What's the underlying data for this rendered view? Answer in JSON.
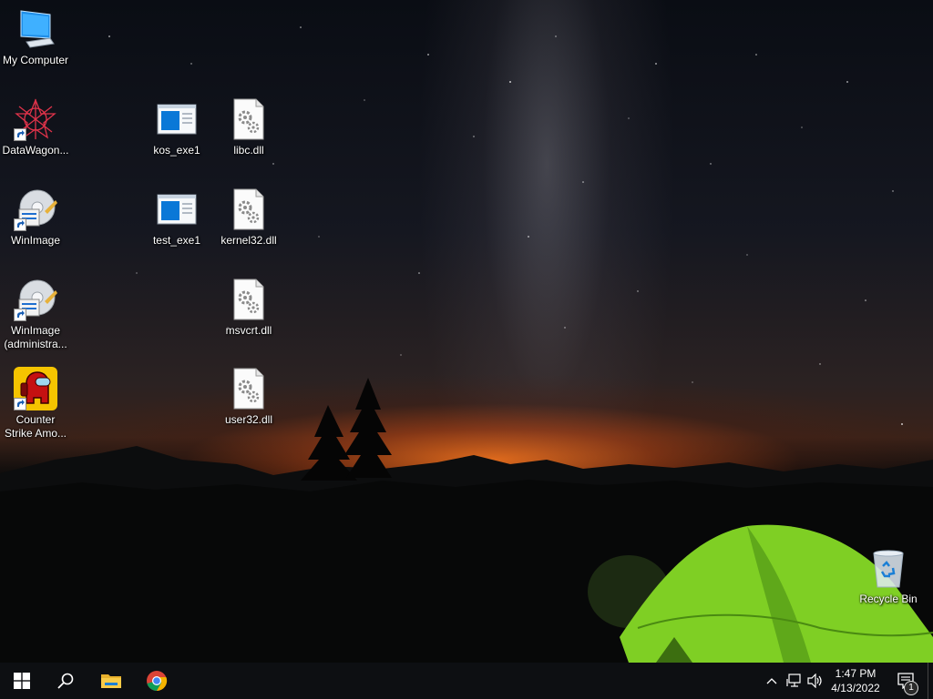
{
  "desktop": {
    "icons": [
      {
        "label": "My Computer",
        "icon": "computer-icon"
      },
      {
        "label": "DataWagon...",
        "icon": "datawagon-icon"
      },
      {
        "label": "WinImage",
        "icon": "winimage-icon"
      },
      {
        "label": "WinImage (administra...",
        "icon": "winimage-icon"
      },
      {
        "label": "Counter Strike Amo...",
        "icon": "among-us-icon"
      },
      {
        "label": "kos_exe1",
        "icon": "exe-icon"
      },
      {
        "label": "test_exe1",
        "icon": "exe-icon"
      },
      {
        "label": "libc.dll",
        "icon": "dll-gear-icon"
      },
      {
        "label": "kernel32.dll",
        "icon": "dll-gear-icon"
      },
      {
        "label": "msvcrt.dll",
        "icon": "dll-gear-icon"
      },
      {
        "label": "user32.dll",
        "icon": "dll-gear-icon"
      },
      {
        "label": "Recycle Bin",
        "icon": "recycle-bin-icon"
      }
    ]
  },
  "taskbar": {
    "pinned": [
      "start-icon",
      "search-icon",
      "file-explorer-icon",
      "chrome-icon"
    ],
    "tray": [
      "chevron-up-icon",
      "network-icon",
      "volume-icon"
    ],
    "clock": {
      "time": "1:47 PM",
      "date": "4/13/2022"
    },
    "notification_count": "1"
  },
  "colors": {
    "taskbar_bg": "#0d0f12",
    "tent_green": "#8ee02a",
    "sunset_orange": "#ff7a1e",
    "windows_blue": "#0a78d7"
  }
}
